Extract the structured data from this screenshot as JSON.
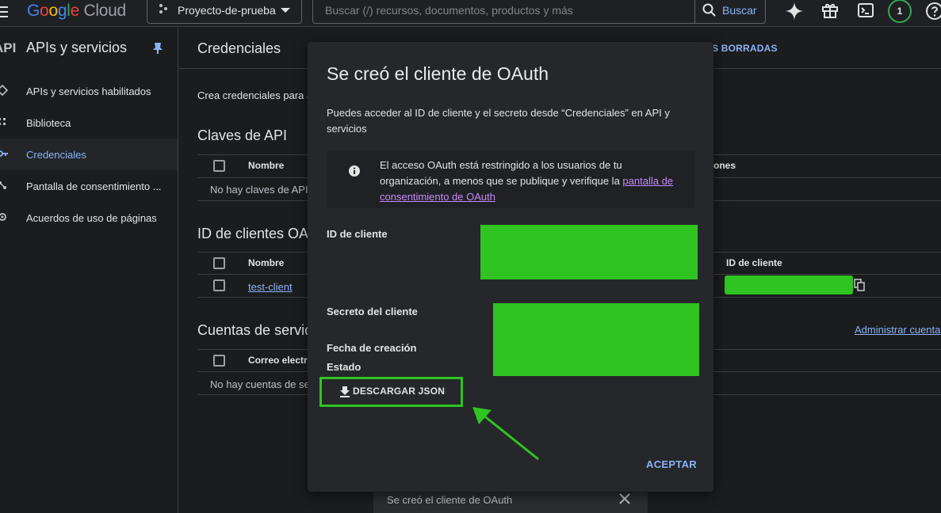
{
  "topbar": {
    "logo_parts": [
      "G",
      "o",
      "o",
      "g",
      "l",
      "e"
    ],
    "logo_cloud": "Cloud",
    "project": "Proyecto-de-prueba",
    "search_placeholder": "Buscar (/) recursos, documentos, productos y más",
    "search_button": "Buscar",
    "notifications_count": "1"
  },
  "sidebar": {
    "api_mark": "API",
    "title": "APIs y servicios",
    "items": [
      {
        "label": "APIs y servicios habilitados"
      },
      {
        "label": "Biblioteca"
      },
      {
        "label": "Credenciales"
      },
      {
        "label": "Pantalla de consentimiento ..."
      },
      {
        "label": "Acuerdos de uso de páginas"
      }
    ]
  },
  "main": {
    "title": "Credenciales",
    "header_link_fragment": "S BORRADAS",
    "intro_fragment": "Crea credenciales para a",
    "api_keys": {
      "title": "Claves de API",
      "col_name": "Nombre",
      "col_right_fragment": "ones",
      "empty": "No hay claves de API"
    },
    "oauth_clients": {
      "title_fragment": "ID de clientes OAu",
      "col_name": "Nombre",
      "col_client_id": "ID de cliente",
      "row_name": "test-client"
    },
    "service_accounts": {
      "title_fragment": "Cuentas de servic",
      "manage_link": "Administrar cuenta",
      "col_email_fragment": "Correo electró",
      "empty_fragment": "No hay cuentas de se"
    }
  },
  "dialog": {
    "title": "Se creó el cliente de OAuth",
    "description": "Puedes acceder al ID de cliente y el secreto desde “Credenciales” en API y servicios",
    "info_text": "El acceso OAuth está restringido a los usuarios de tu organización, a menos que se publique y verifique la ",
    "info_link": "pantalla de consentimiento de OAuth",
    "client_id_label": "ID de cliente",
    "client_secret_label": "Secreto del cliente",
    "created_label": "Fecha de creación",
    "status_label": "Estado",
    "download_button": "DESCARGAR JSON",
    "accept_button": "ACEPTAR"
  },
  "snackbar": {
    "message": "Se creó el cliente de OAuth"
  },
  "colors": {
    "redaction_green": "#2fc421",
    "accent_blue": "#8ab4f8",
    "link_purple": "#c58af9",
    "annotation_arrow": "#2fc421"
  }
}
